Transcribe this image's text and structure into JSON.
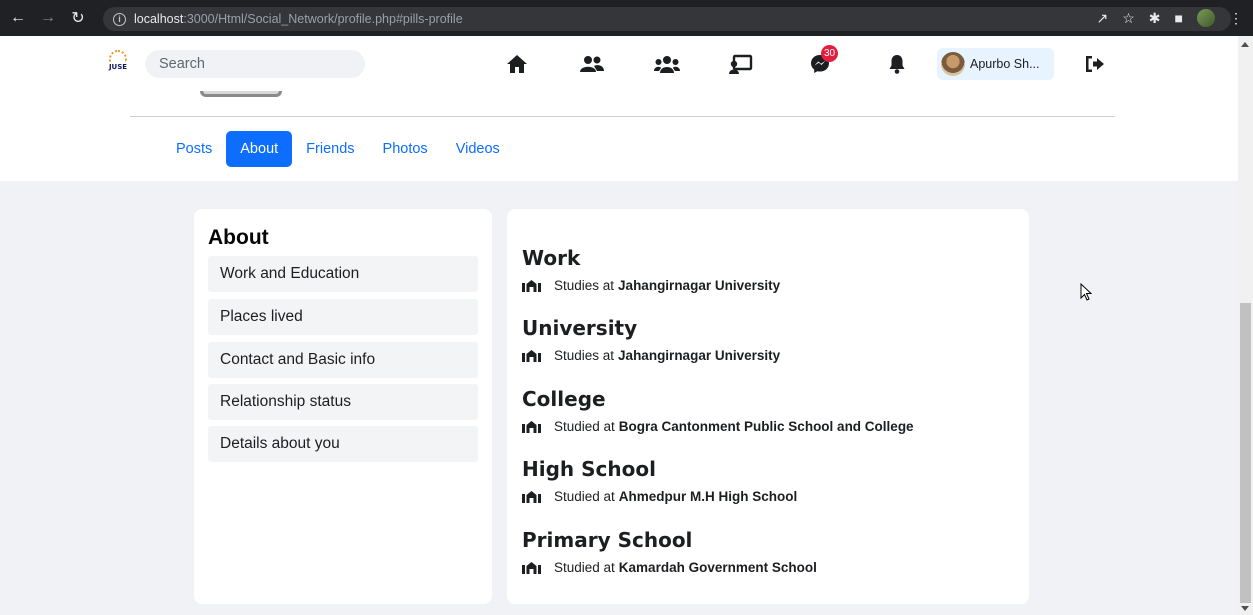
{
  "browser": {
    "url_host": "localhost",
    "url_path": ":3000/Html/Social_Network/profile.php#pills-profile"
  },
  "navbar": {
    "logo_text": "JUSE",
    "search_placeholder": "Search",
    "messenger_badge": "30",
    "user_name": "Apurbo Sh..."
  },
  "tabs": [
    {
      "label": "Posts",
      "active": false
    },
    {
      "label": "About",
      "active": true
    },
    {
      "label": "Friends",
      "active": false
    },
    {
      "label": "Photos",
      "active": false
    },
    {
      "label": "Videos",
      "active": false
    }
  ],
  "about": {
    "title": "About",
    "items": [
      "Work and Education",
      "Places lived",
      "Contact and Basic info",
      "Relationship status",
      "Details about you"
    ]
  },
  "details": [
    {
      "heading": "Work",
      "prefix": "Studies at",
      "place": "Jahangirnagar University"
    },
    {
      "heading": "University",
      "prefix": "Studies at",
      "place": "Jahangirnagar University"
    },
    {
      "heading": "College",
      "prefix": "Studied at",
      "place": "Bogra Cantonment Public School and College"
    },
    {
      "heading": "High School",
      "prefix": "Studied at",
      "place": "Ahmedpur M.H High School"
    },
    {
      "heading": "Primary School",
      "prefix": "Studied at",
      "place": "Kamardah Government School"
    }
  ],
  "colors": {
    "accent": "#0d6efd",
    "badge": "#e41e3f",
    "page_bg": "#f0f2f5"
  }
}
